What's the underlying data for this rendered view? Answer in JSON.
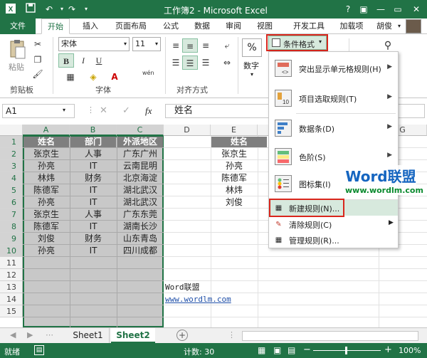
{
  "window": {
    "title": "工作簿2 - Microsoft Excel",
    "user": "胡俊"
  },
  "tabs": [
    "文件",
    "开始",
    "插入",
    "页面布局",
    "公式",
    "数据",
    "审阅",
    "视图",
    "开发工具",
    "加载项"
  ],
  "ribbon": {
    "paste_label": "粘贴",
    "font_name": "宋体",
    "font_size": "11",
    "bold": "B",
    "italic": "I",
    "underline": "U",
    "number_label": "数字",
    "percent": "%",
    "wen": "wén",
    "cf_button": "条件格式",
    "groups": {
      "clipboard": "剪贴板",
      "font": "字体",
      "align": "对齐方式"
    }
  },
  "formula_bar": {
    "name_box": "A1",
    "fx": "fx",
    "value": "姓名"
  },
  "columns": [
    "A",
    "B",
    "C",
    "D",
    "E",
    "F",
    "G"
  ],
  "rows": [
    "1",
    "2",
    "3",
    "4",
    "5",
    "6",
    "7",
    "8",
    "9",
    "10",
    "11",
    "12",
    "13",
    "14",
    "15"
  ],
  "table_main": {
    "headers": [
      "姓名",
      "部门",
      "外派地区"
    ],
    "rows": [
      [
        "张京生",
        "人事",
        "广东广州"
      ],
      [
        "孙亮",
        "IT",
        "云南昆明"
      ],
      [
        "林炜",
        "财务",
        "北京海淀"
      ],
      [
        "陈德军",
        "IT",
        "湖北武汉"
      ],
      [
        "孙亮",
        "IT",
        "湖北武汉"
      ],
      [
        "张京生",
        "人事",
        "广东东莞"
      ],
      [
        "陈德军",
        "IT",
        "湖南长沙"
      ],
      [
        "刘俊",
        "财务",
        "山东青岛"
      ],
      [
        "孙亮",
        "IT",
        "四川成都"
      ]
    ]
  },
  "table_side": {
    "header": "姓名",
    "values": [
      "张京生",
      "孙亮",
      "陈德军",
      "林炜",
      "刘俊"
    ]
  },
  "notes": {
    "a13": "Word联盟",
    "a14": "www.wordlm.com"
  },
  "menu": {
    "items": [
      {
        "label": "突出显示单元格规则(H)",
        "arrow": "▶"
      },
      {
        "label": "项目选取规则(T)",
        "arrow": "▶"
      },
      {
        "label": "数据条(D)",
        "arrow": "▶"
      },
      {
        "label": "色阶(S)",
        "arrow": "▶"
      },
      {
        "label": "图标集(I)",
        "arrow": "▶"
      }
    ],
    "small": [
      {
        "label": "新建规则(N)..."
      },
      {
        "label": "清除规则(C)",
        "arrow": "▶"
      },
      {
        "label": "管理规则(R)..."
      }
    ]
  },
  "watermark": {
    "brand": "Word联盟",
    "url": "www.wordlm.com"
  },
  "sheets": [
    "Sheet1",
    "Sheet2"
  ],
  "status": {
    "ready": "就绪",
    "count": "计数: 30",
    "zoom": "100%",
    "minus": "−",
    "plus": "+"
  },
  "colors": {
    "accent": "#217346",
    "highlight": "#d9261c"
  }
}
